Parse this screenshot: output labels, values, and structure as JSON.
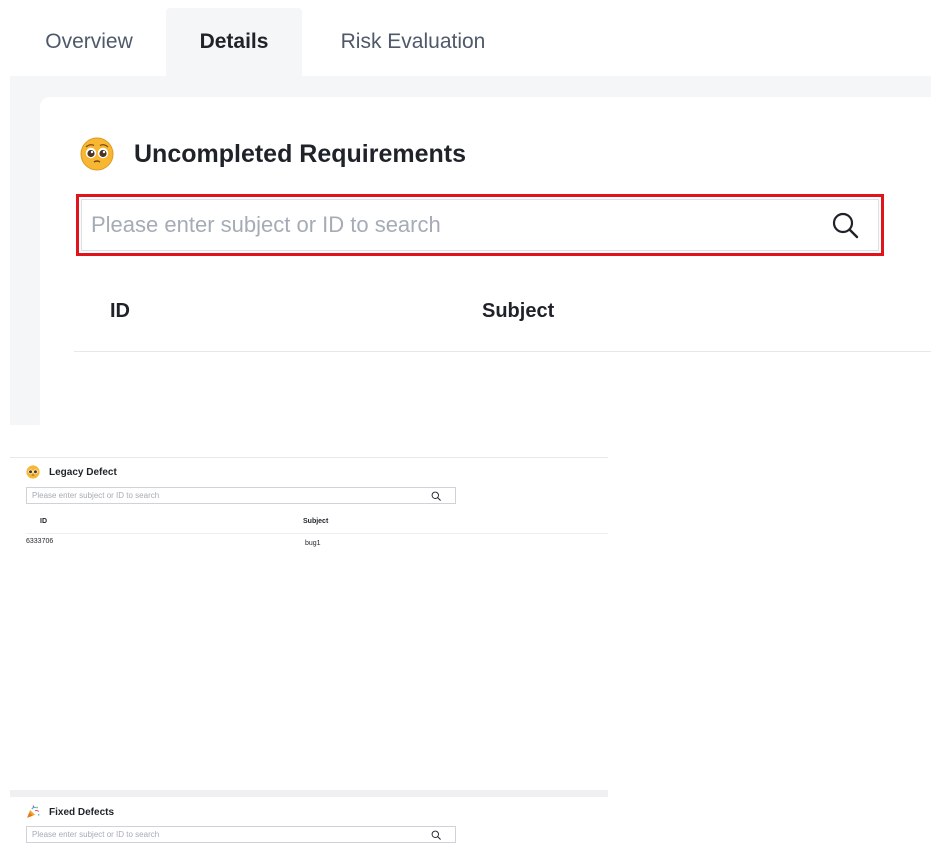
{
  "tabs": [
    {
      "label": "Overview",
      "active": false
    },
    {
      "label": "Details",
      "active": true
    },
    {
      "label": "Risk Evaluation",
      "active": false
    }
  ],
  "uncompleted": {
    "title": "Uncompleted Requirements",
    "emoji_icon": "pleading-face-icon",
    "search": {
      "placeholder": "Please enter subject or ID to search",
      "value": ""
    },
    "columns": [
      "ID",
      "Subject"
    ],
    "rows": []
  },
  "legacy": {
    "title": "Legacy Defect",
    "emoji_icon": "pleading-face-icon",
    "search": {
      "placeholder": "Please enter subject or ID to search",
      "value": ""
    },
    "columns": [
      "ID",
      "Subject"
    ],
    "rows": [
      {
        "id": "6333706",
        "subject": "bug1"
      }
    ]
  },
  "fixed": {
    "title": "Fixed Defects",
    "emoji_icon": "party-popper-icon",
    "search": {
      "placeholder": "Please enter subject or ID to search",
      "value": ""
    }
  },
  "colors": {
    "highlight": "#e0151b",
    "panel_bg": "#f5f6f7",
    "text": "#1f2329",
    "placeholder": "#a5acb6"
  }
}
